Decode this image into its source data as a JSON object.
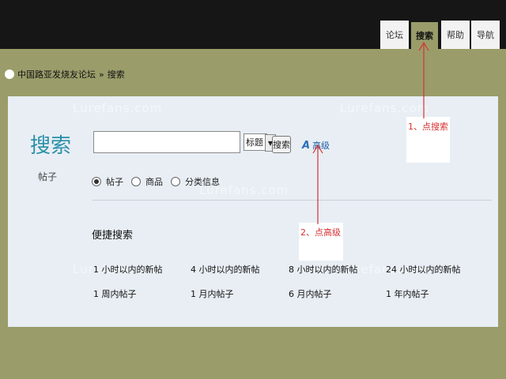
{
  "nav": {
    "tabs": [
      {
        "label": "论坛"
      },
      {
        "label": "搜索"
      },
      {
        "label": "帮助"
      },
      {
        "label": "导航"
      }
    ]
  },
  "breadcrumb": {
    "home": "中国路亚发烧友论坛",
    "separator": "»",
    "current": "搜索"
  },
  "watermark": "Lurefans.com",
  "search": {
    "title": "搜索",
    "subtitle": "帖子",
    "input_value": "",
    "field_select": "标题",
    "button_label": "搜索",
    "advanced_label": "高级",
    "types": [
      {
        "label": "帖子",
        "selected": true
      },
      {
        "label": "商品",
        "selected": false
      },
      {
        "label": "分类信息",
        "selected": false
      }
    ]
  },
  "quick": {
    "title": "便捷搜索",
    "links": [
      "1 小时以内的新帖",
      "4 小时以内的新帖",
      "8 小时以内的新帖",
      "24 小时以内的新帖",
      "1 周内帖子",
      "1 月内帖子",
      "6 月内帖子",
      "1 年内帖子"
    ]
  },
  "annotations": {
    "step1": "1、点搜索",
    "step2": "2、点高级",
    "color": "#d63030"
  },
  "colors": {
    "topbar": "#161616",
    "background": "#9a9d6a",
    "panel": "#e8eef4",
    "title_accent": "#2a8fa8"
  }
}
